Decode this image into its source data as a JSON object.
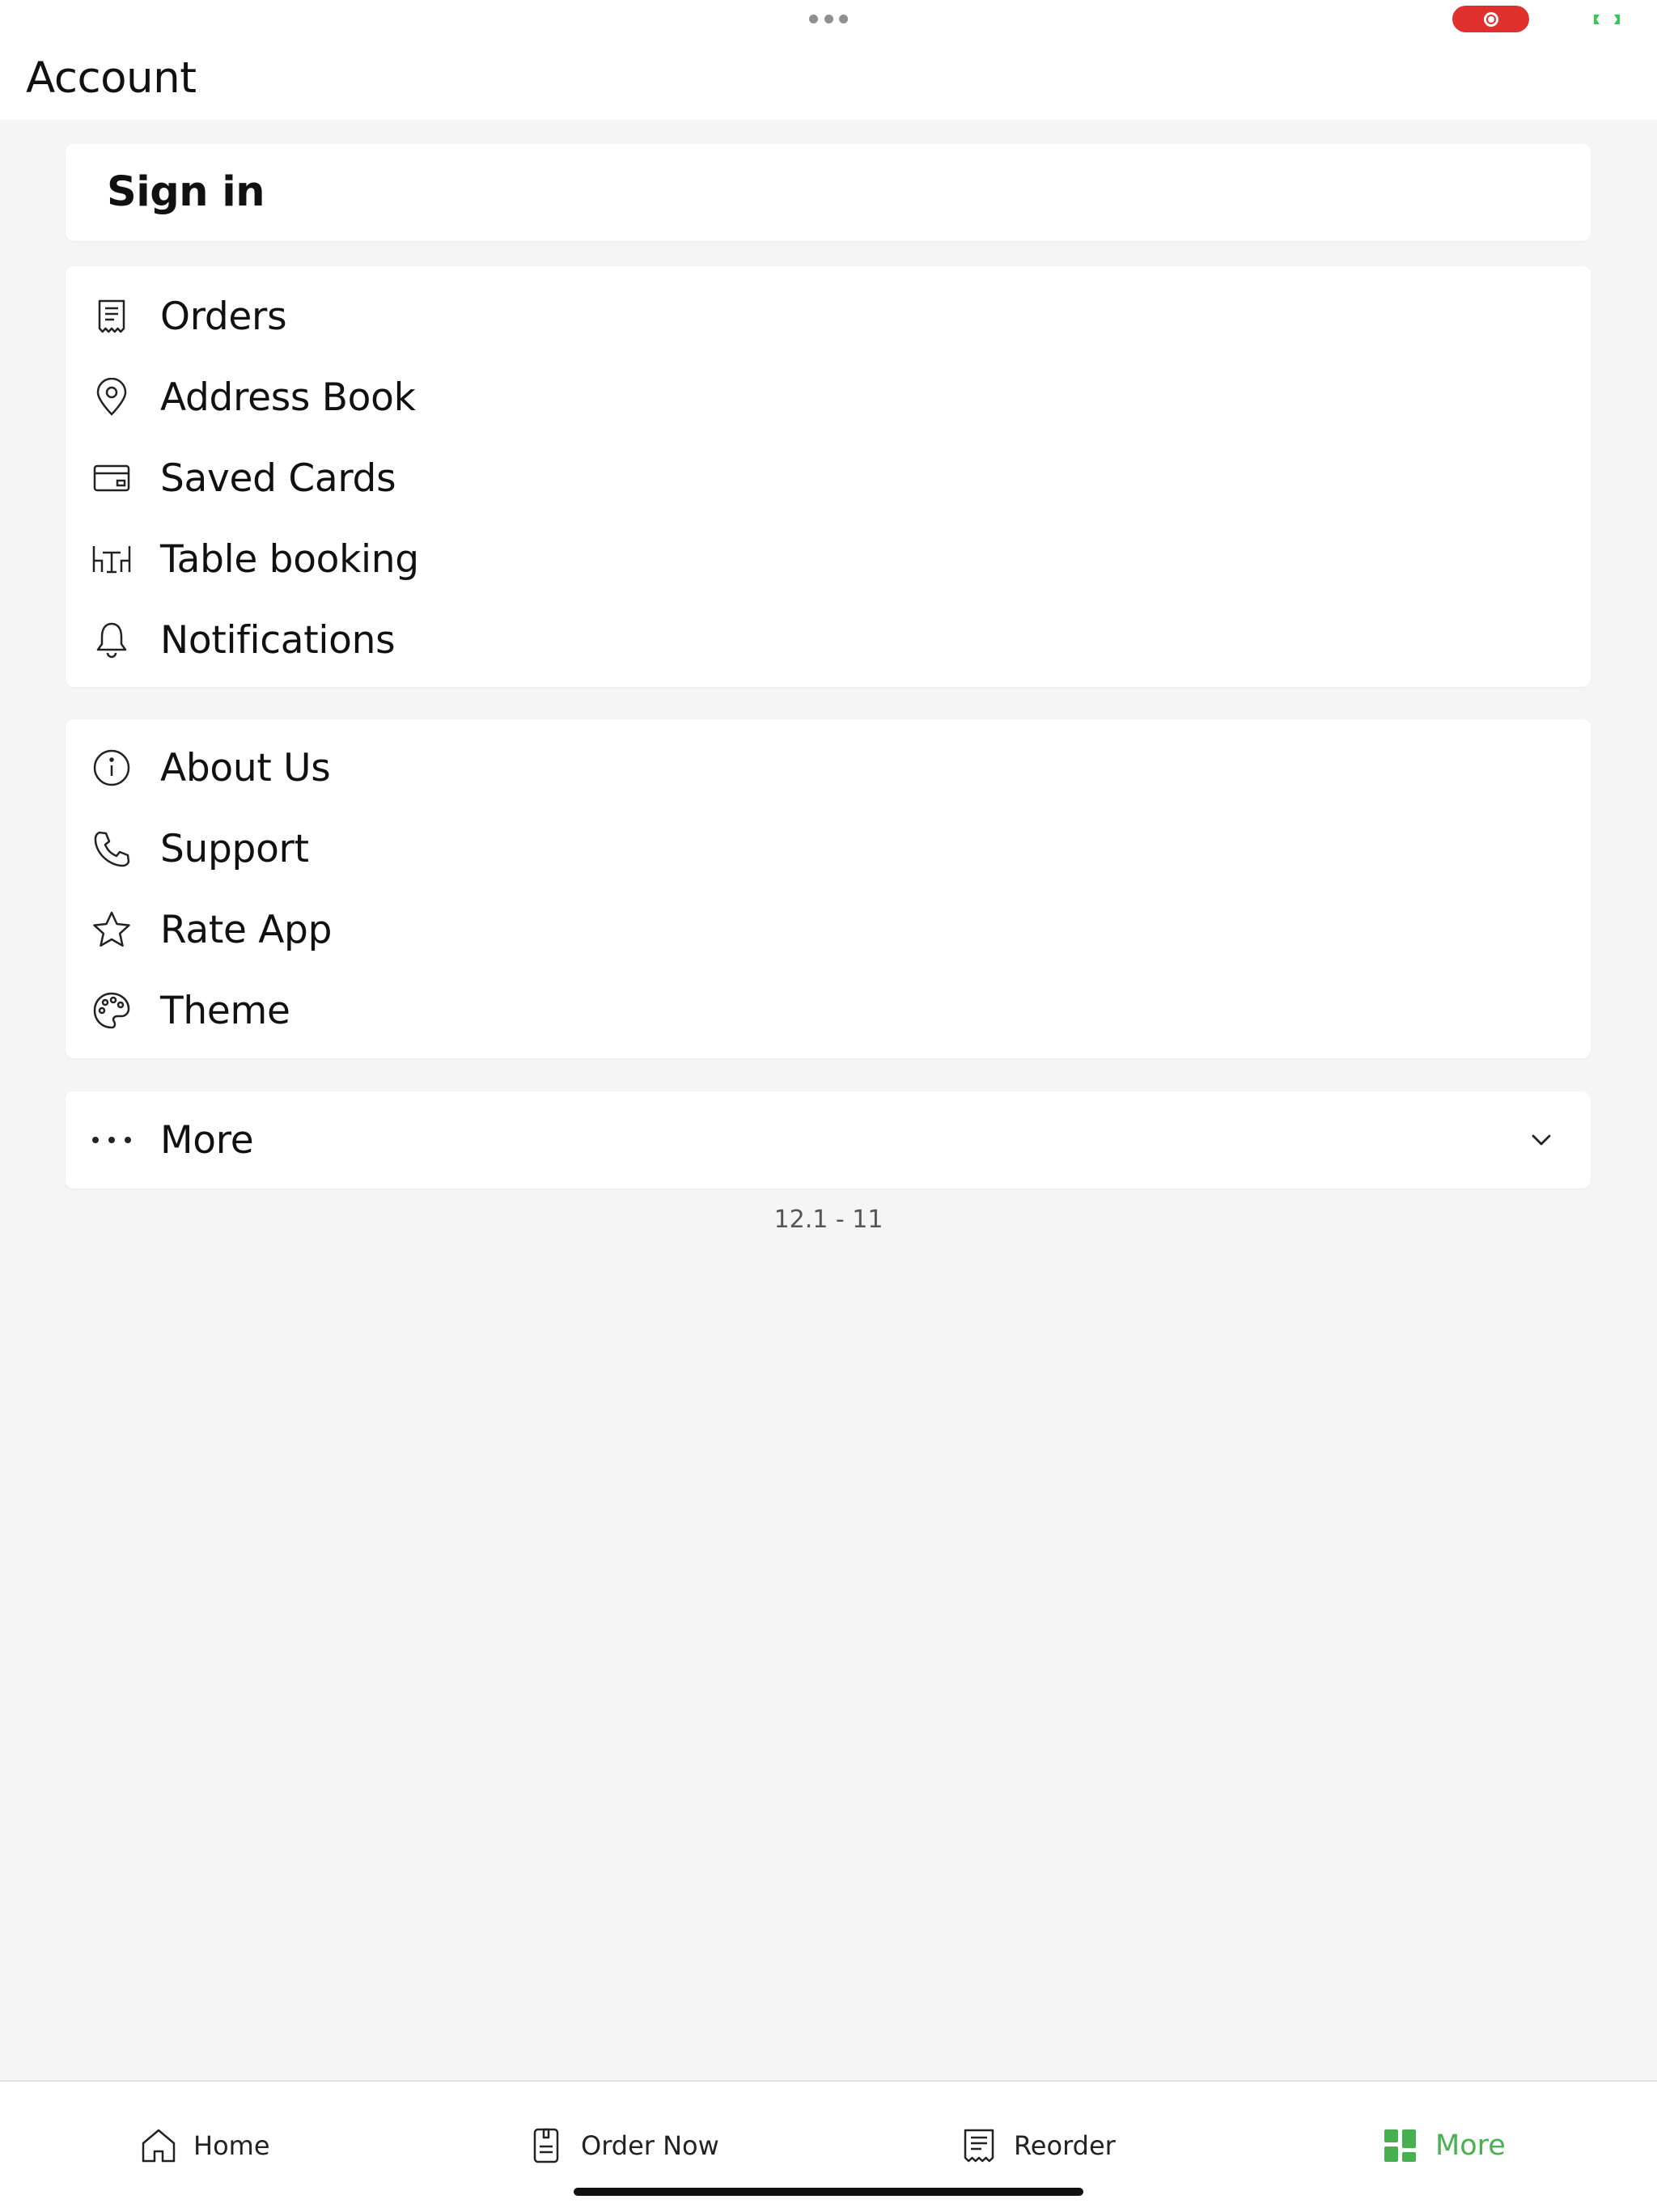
{
  "page": {
    "title": "Account",
    "version": "12.1 - 11"
  },
  "signin": {
    "label": "Sign in"
  },
  "account_menu": [
    {
      "label": "Orders",
      "icon": "receipt-icon"
    },
    {
      "label": "Address Book",
      "icon": "location-pin-icon"
    },
    {
      "label": "Saved Cards",
      "icon": "card-icon"
    },
    {
      "label": "Table booking",
      "icon": "table-icon"
    },
    {
      "label": "Notifications",
      "icon": "bell-icon"
    }
  ],
  "info_menu": [
    {
      "label": "About Us",
      "icon": "info-icon"
    },
    {
      "label": "Support",
      "icon": "phone-icon"
    },
    {
      "label": "Rate App",
      "icon": "star-icon"
    },
    {
      "label": "Theme",
      "icon": "palette-icon"
    }
  ],
  "more_section": {
    "label": "More",
    "icon": "ellipsis-icon",
    "expanded": false
  },
  "tabbar": {
    "items": [
      {
        "label": "Home",
        "icon": "home-icon",
        "active": false
      },
      {
        "label": "Order Now",
        "icon": "order-icon",
        "active": false
      },
      {
        "label": "Reorder",
        "icon": "reorder-icon",
        "active": false
      },
      {
        "label": "More",
        "icon": "grid-icon",
        "active": true
      }
    ]
  },
  "colors": {
    "accent": "#47b14f",
    "background": "#f5f5f5",
    "card": "#ffffff",
    "record": "#e0302e"
  }
}
